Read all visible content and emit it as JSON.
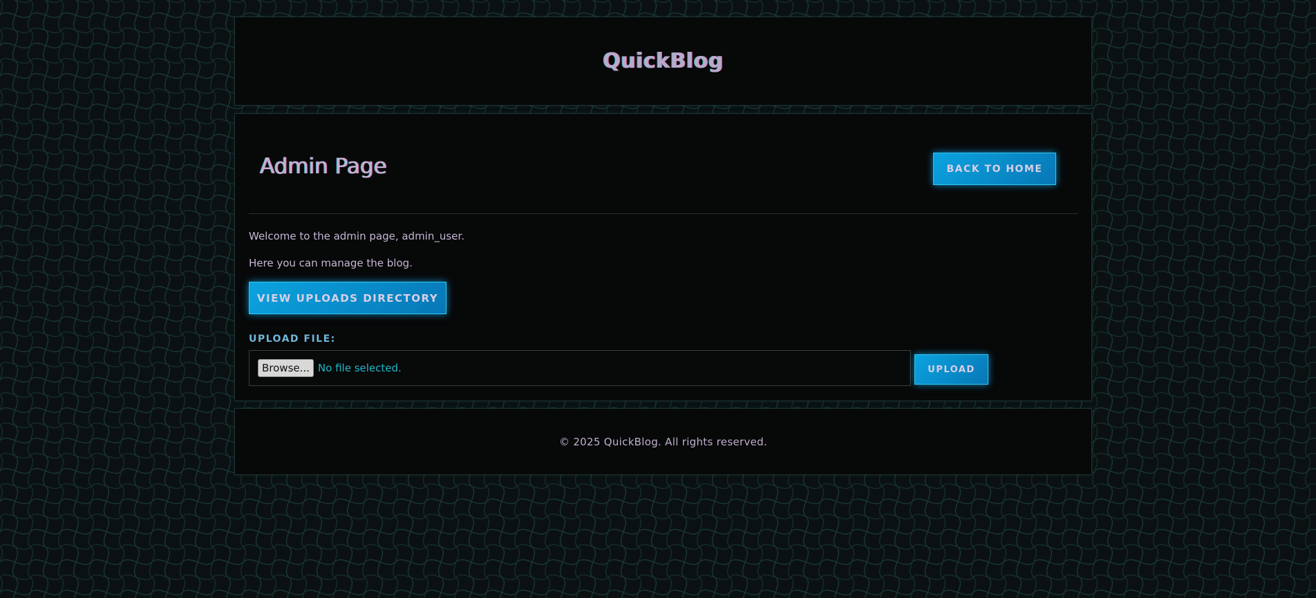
{
  "header": {
    "title": "QuickBlog"
  },
  "main": {
    "page_title": "Admin Page",
    "back_button": "BACK TO HOME",
    "welcome_text": "Welcome to the admin page, admin_user.",
    "manage_text": "Here you can manage the blog.",
    "uploads_button": "VIEW UPLOADS DIRECTORY",
    "upload_label": "UPLOAD FILE:",
    "file_input": {
      "browse_label": "Browse...",
      "status": "No file selected."
    },
    "upload_button": "UPLOAD"
  },
  "footer": {
    "text": "© 2025 QuickBlog. All rights reserved."
  },
  "colors": {
    "background": "#0b1112",
    "panel": "#070808",
    "accent": "#0aa3df",
    "text": "#c9b8d6",
    "label": "#6fb6d8",
    "file_status": "#1fb7c9"
  }
}
